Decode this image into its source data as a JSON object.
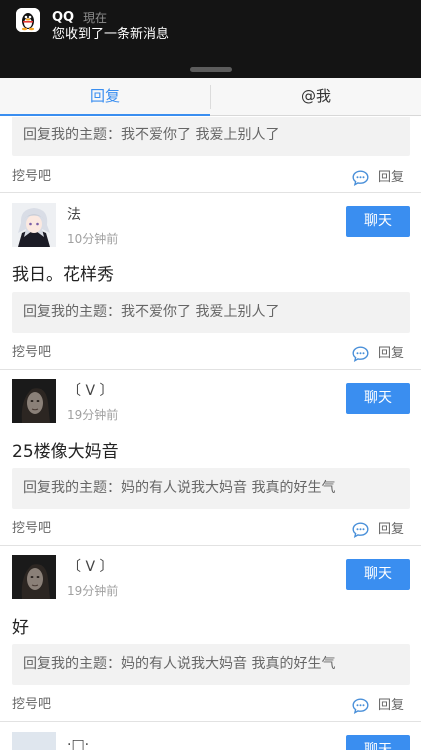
{
  "notification": {
    "app_name": "QQ",
    "time": "現在",
    "message": "您收到了一条新消息"
  },
  "tabs": [
    {
      "label": "回复",
      "active": true
    },
    {
      "label": "@我",
      "active": false
    }
  ],
  "colors": {
    "accent": "#3a8ef0",
    "banner_bg": "#141414",
    "quote_bg": "#f2f2f2"
  },
  "partial_top_post": {
    "quote": "回复我的主题：我不爱你了 我爱上别人了",
    "forum": "挖号吧",
    "reply_label": "回复"
  },
  "posts": [
    {
      "username": "法",
      "time": "10分钟前",
      "chat_label": "聊天",
      "content": "我日。花样秀",
      "quote": "回复我的主题：我不爱你了 我爱上别人了",
      "forum": "挖号吧",
      "reply_label": "回复",
      "avatar_icon": "anime-avatar-icon"
    },
    {
      "username": "〔 V 〕",
      "time": "19分钟前",
      "chat_label": "聊天",
      "content": "25楼像大妈音",
      "quote": "回复我的主题：妈的有人说我大妈音 我真的好生气",
      "forum": "挖号吧",
      "reply_label": "回复",
      "avatar_icon": "dark-portrait-avatar-icon"
    },
    {
      "username": "〔 V 〕",
      "time": "19分钟前",
      "chat_label": "聊天",
      "content": "好",
      "quote": "回复我的主题：妈的有人说我大妈音 我真的好生气",
      "forum": "挖号吧",
      "reply_label": "回复",
      "avatar_icon": "dark-portrait-avatar-icon"
    }
  ],
  "partial_bottom_post": {
    "username": "·□·",
    "chat_label": "聊天"
  }
}
